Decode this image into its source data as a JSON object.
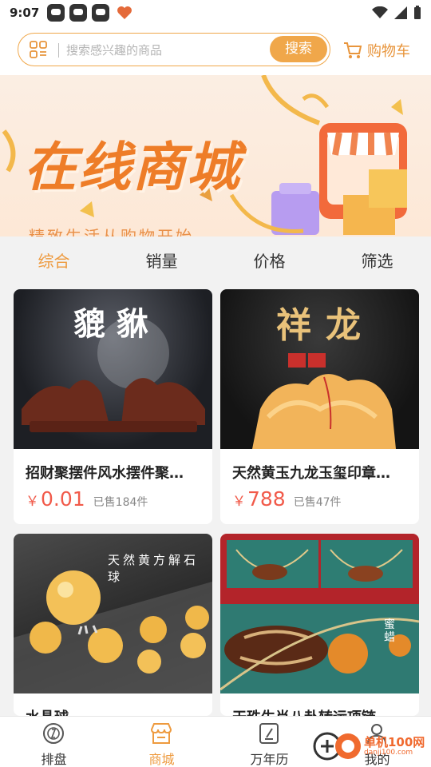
{
  "status_bar": {
    "time": "9:07"
  },
  "header": {
    "search_placeholder": "搜索感兴趣的商品",
    "search_button": "搜索",
    "cart_label": "购物车"
  },
  "banner": {
    "title": "在线商城",
    "subtitle": "精致生活从购物开始"
  },
  "sort_tabs": [
    {
      "label": "综合",
      "active": true
    },
    {
      "label": "销量",
      "active": false
    },
    {
      "label": "价格",
      "active": false
    },
    {
      "label": "筛选",
      "active": false
    }
  ],
  "products": [
    {
      "name": "招财聚摆件风水摆件聚…",
      "currency": "￥",
      "price": "0.01",
      "sold": "已售184件",
      "image_text": "貔貅"
    },
    {
      "name": "天然黄玉九龙玉玺印章…",
      "currency": "￥",
      "price": "788",
      "sold": "已售47件",
      "image_text": "祥龙"
    },
    {
      "name": "水晶球",
      "image_text": "天然黄方解石球"
    },
    {
      "name": "天珠生肖八卦转运项链",
      "image_text": "蜜蜡"
    }
  ],
  "bottom_nav": [
    {
      "label": "排盘",
      "icon": "compass-icon",
      "active": false
    },
    {
      "label": "商城",
      "icon": "shop-icon",
      "active": true
    },
    {
      "label": "万年历",
      "icon": "calendar-icon",
      "active": false
    },
    {
      "label": "我的",
      "icon": "profile-icon",
      "active": false
    }
  ],
  "watermark": {
    "text": "单机100网",
    "url": "danji100.com"
  },
  "colors": {
    "accent": "#ee9a3e",
    "price": "#f15a4a",
    "button": "#f0a74a"
  }
}
